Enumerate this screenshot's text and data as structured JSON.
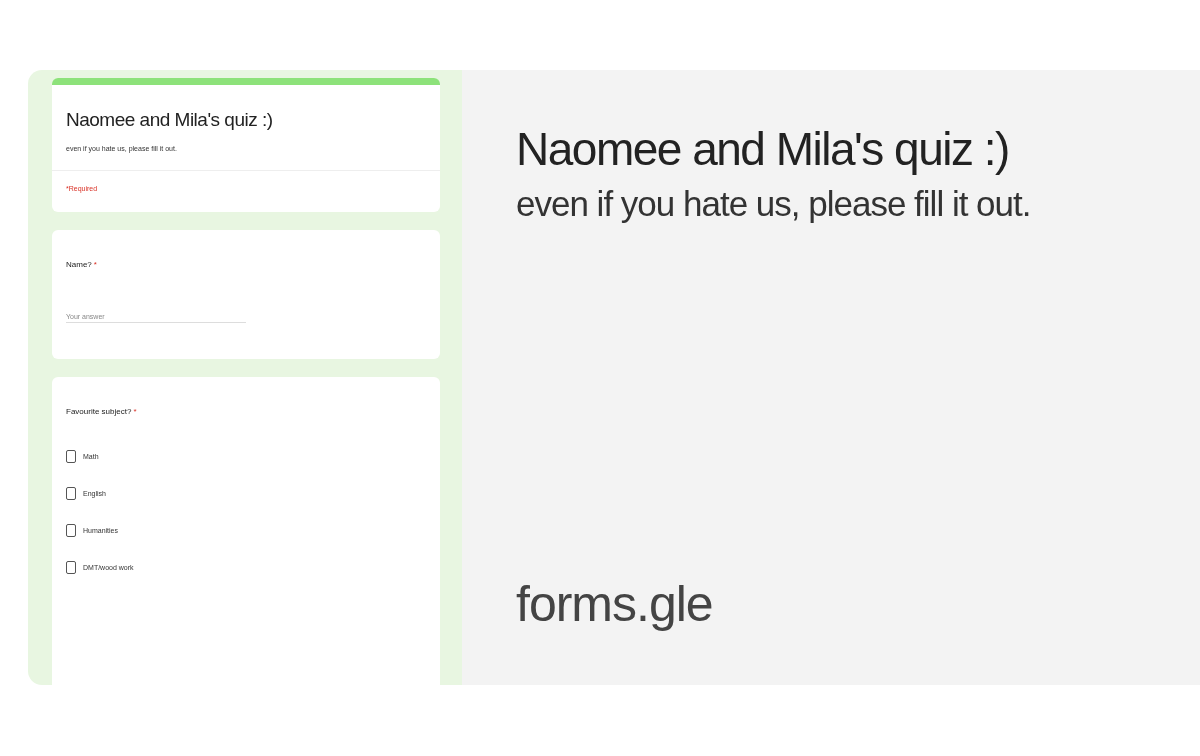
{
  "preview": {
    "form": {
      "title": "Naomee and Mila's quiz :)",
      "description": "even if you hate us, please fill it out.",
      "required_note": "*Required",
      "questions": [
        {
          "kind": "text",
          "label": "Name?",
          "required_mark": "*",
          "placeholder": "Your answer"
        },
        {
          "kind": "checkbox",
          "label": "Favourite subject?",
          "required_mark": "*",
          "options": [
            {
              "label": "Math",
              "checked": false
            },
            {
              "label": "English",
              "checked": false
            },
            {
              "label": "Humanities",
              "checked": false
            },
            {
              "label": "DMT/wood work",
              "checked": false
            }
          ]
        }
      ]
    },
    "title": "Naomee and Mila's quiz :)",
    "description": "even if you hate us, please fill it out.",
    "domain": "forms.gle"
  }
}
